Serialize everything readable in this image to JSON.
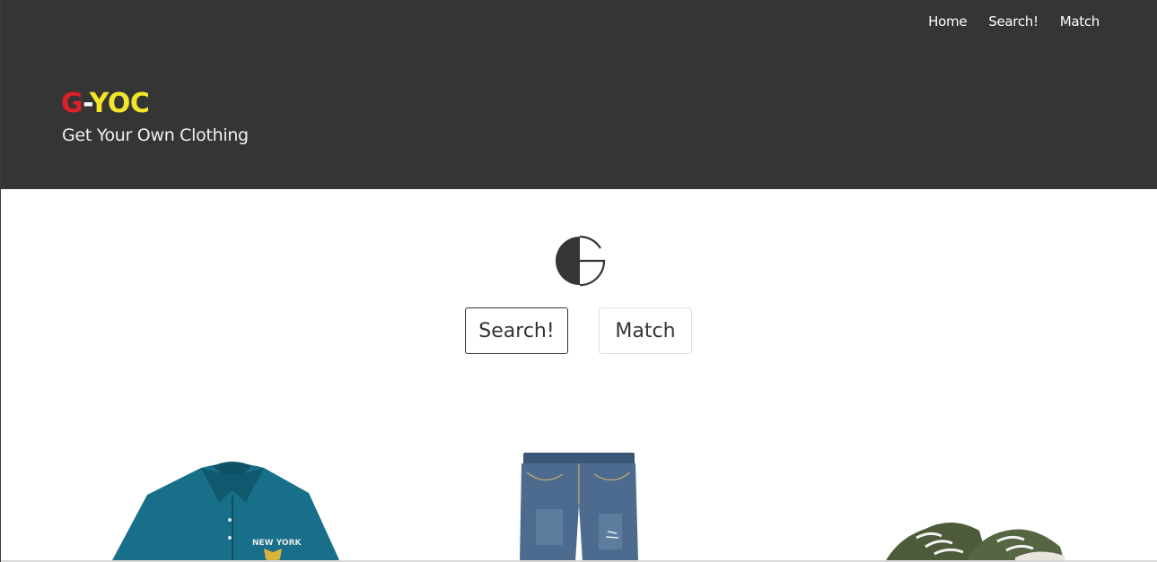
{
  "nav": {
    "items": [
      {
        "label": "Home"
      },
      {
        "label": "Search!"
      },
      {
        "label": "Match"
      }
    ]
  },
  "brand": {
    "g": "G",
    "dash": "-",
    "yoc": "YOC",
    "tagline": "Get Your Own Clothing"
  },
  "actions": {
    "search_label": "Search!",
    "match_label": "Match"
  },
  "products": [
    {
      "kind": "teal polo shirt",
      "print": "NEW YORK"
    },
    {
      "kind": "denim shorts"
    },
    {
      "kind": "green canvas sneakers"
    }
  ],
  "colors": {
    "header_bg": "#353535",
    "brand_g": "#e01f26",
    "brand_yoc": "#f2e62a",
    "polo": "#176f8a",
    "denim": "#4c6b8e",
    "sneaker": "#4d5b3a"
  },
  "icons": {
    "logo": "g-logo-icon"
  }
}
